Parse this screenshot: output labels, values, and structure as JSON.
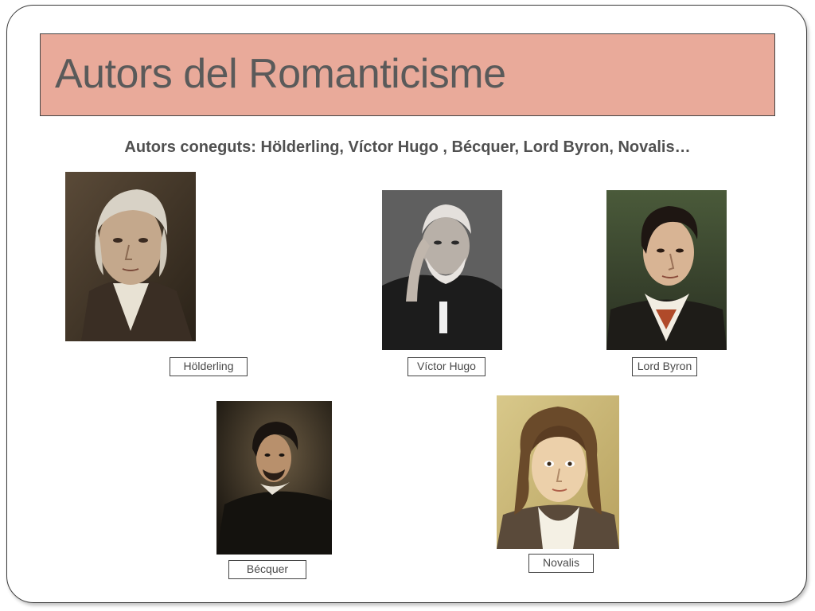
{
  "slide": {
    "title": "Autors del Romanticisme",
    "subtitle": "Autors coneguts: Hölderling, Víctor Hugo , Bécquer, Lord Byron, Novalis…"
  },
  "portraits": [
    {
      "id": "holderling",
      "caption": "Hölderling"
    },
    {
      "id": "victor-hugo",
      "caption": "Víctor Hugo"
    },
    {
      "id": "lord-byron",
      "caption": "Lord Byron"
    },
    {
      "id": "becquer",
      "caption": "Bécquer"
    },
    {
      "id": "novalis",
      "caption": "Novalis"
    }
  ],
  "colors": {
    "title_banner": "#e9aa9a",
    "title_text": "#5a5a5a",
    "subtitle_text": "#505050"
  }
}
